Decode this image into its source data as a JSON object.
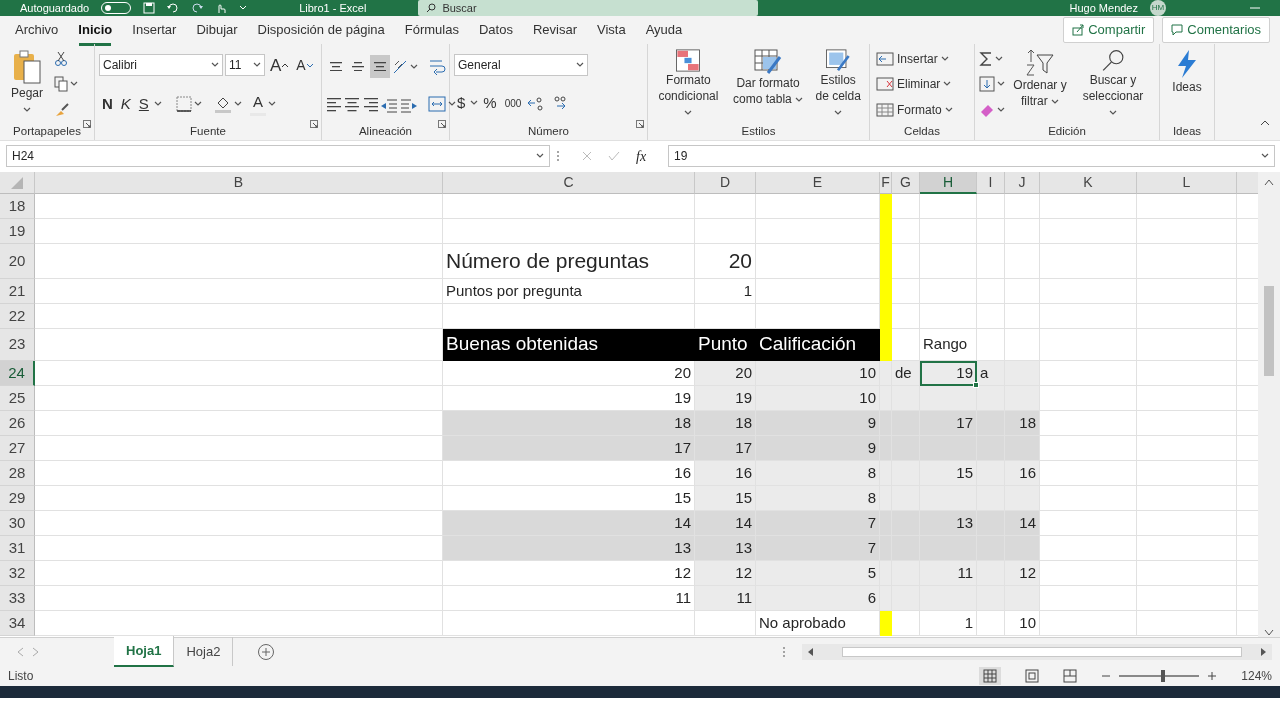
{
  "title_bar": {
    "autosave": "Autoguardado",
    "autosave_on": false,
    "document": "Libro1 - Excel",
    "search_placeholder": "Buscar",
    "user": "Hugo Mendez",
    "initials": "HM"
  },
  "tabs": [
    {
      "label": "Archivo",
      "selected": false
    },
    {
      "label": "Inicio",
      "selected": true
    },
    {
      "label": "Insertar",
      "selected": false
    },
    {
      "label": "Dibujar",
      "selected": false
    },
    {
      "label": "Disposición de página",
      "selected": false
    },
    {
      "label": "Fórmulas",
      "selected": false
    },
    {
      "label": "Datos",
      "selected": false
    },
    {
      "label": "Revisar",
      "selected": false
    },
    {
      "label": "Vista",
      "selected": false
    },
    {
      "label": "Ayuda",
      "selected": false
    }
  ],
  "share_button": "Compartir",
  "comments_button": "Comentarios",
  "ribbon": {
    "groups": [
      {
        "label": "Portapapeles",
        "launcher": true,
        "paste": "Pegar"
      },
      {
        "label": "Fuente",
        "launcher": true,
        "font": "Calibri",
        "size": "11",
        "grow": "A",
        "shrink": "A",
        "bold": "N",
        "italic": "K",
        "underline": "S",
        "font_color": "A"
      },
      {
        "label": "Alineación",
        "launcher": true,
        "vertical_align": [
          {
            "selected": false
          },
          {
            "selected": false
          },
          {
            "selected": true
          }
        ]
      },
      {
        "label": "Número",
        "launcher": true,
        "format": "General",
        "currency": "$",
        "percent": "%",
        "thousands": "000"
      },
      {
        "label": "Estilos",
        "launcher": false,
        "buttons": [
          "Formato condicional",
          "Dar formato como tabla",
          "Estilos de celda"
        ]
      },
      {
        "label": "Celdas",
        "launcher": false,
        "buttons": [
          "Insertar",
          "Eliminar",
          "Formato"
        ]
      },
      {
        "label": "Edición",
        "launcher": false,
        "buttons": [
          "Ordenar y filtrar",
          "Buscar y seleccionar"
        ]
      },
      {
        "label": "Ideas",
        "launcher": false,
        "buttons": [
          "Ideas"
        ]
      }
    ]
  },
  "formula_bar": {
    "name_box": "H24",
    "function_label": "fx",
    "value": "19"
  },
  "columns": [
    {
      "label": "B",
      "selected": false
    },
    {
      "label": "C",
      "selected": false
    },
    {
      "label": "D",
      "selected": false
    },
    {
      "label": "E",
      "selected": false
    },
    {
      "label": "F",
      "selected": false
    },
    {
      "label": "G",
      "selected": false
    },
    {
      "label": "H",
      "selected": true
    },
    {
      "label": "I",
      "selected": false
    },
    {
      "label": "J",
      "selected": false
    },
    {
      "label": "K",
      "selected": false
    },
    {
      "label": "L",
      "selected": false
    }
  ],
  "rows": [
    {
      "number": "18",
      "selected": false,
      "kind": "marker"
    },
    {
      "number": "19",
      "selected": false,
      "kind": "marker"
    },
    {
      "number": "20",
      "selected": false,
      "kind": "marker",
      "large": true,
      "labels": {
        "C": "Número de preguntas"
      },
      "values": {
        "D": "20"
      }
    },
    {
      "number": "21",
      "selected": false,
      "kind": "marker",
      "labels": {
        "C": "Puntos por pregunta"
      },
      "values": {
        "D": "1"
      }
    },
    {
      "number": "22",
      "selected": false,
      "kind": "marker"
    },
    {
      "number": "23",
      "selected": false,
      "kind": "header",
      "labels": {
        "C": "Buenas obtenidas",
        "D": "Punto",
        "E": "Calificación",
        "H": "Rango"
      }
    },
    {
      "number": "24",
      "selected": true,
      "kind": "light",
      "values": {
        "C": "20",
        "D": "20",
        "E": "10",
        "H": "19"
      },
      "labels": {
        "G": "de",
        "I": "a"
      }
    },
    {
      "number": "25",
      "selected": false,
      "kind": "light",
      "values": {
        "C": "19",
        "D": "19",
        "E": "10"
      }
    },
    {
      "number": "26",
      "selected": false,
      "kind": "shaded",
      "values": {
        "C": "18",
        "D": "18",
        "E": "9",
        "H": "17",
        "J": "18"
      }
    },
    {
      "number": "27",
      "selected": false,
      "kind": "shaded",
      "values": {
        "C": "17",
        "D": "17",
        "E": "9"
      }
    },
    {
      "number": "28",
      "selected": false,
      "kind": "light",
      "values": {
        "C": "16",
        "D": "16",
        "E": "8",
        "H": "15",
        "J": "16"
      }
    },
    {
      "number": "29",
      "selected": false,
      "kind": "light",
      "values": {
        "C": "15",
        "D": "15",
        "E": "8"
      }
    },
    {
      "number": "30",
      "selected": false,
      "kind": "shaded",
      "values": {
        "C": "14",
        "D": "14",
        "E": "7",
        "H": "13",
        "J": "14"
      }
    },
    {
      "number": "31",
      "selected": false,
      "kind": "shaded",
      "values": {
        "C": "13",
        "D": "13",
        "E": "7"
      }
    },
    {
      "number": "32",
      "selected": false,
      "kind": "light",
      "values": {
        "C": "12",
        "D": "12",
        "E": "5",
        "H": "11",
        "J": "12"
      }
    },
    {
      "number": "33",
      "selected": false,
      "kind": "light",
      "values": {
        "C": "11",
        "D": "11",
        "E": "6"
      }
    },
    {
      "number": "34",
      "selected": false,
      "kind": "marker",
      "labels": {
        "E": "No aprobado"
      },
      "values": {
        "H": "1",
        "J": "10"
      }
    }
  ],
  "sheet_tabs": [
    {
      "label": "Hoja1",
      "selected": true
    },
    {
      "label": "Hoja2",
      "selected": false
    }
  ],
  "status_bar": {
    "status": "Listo",
    "zoom": {
      "level": 0.55
    },
    "zoom_label": "124%"
  }
}
